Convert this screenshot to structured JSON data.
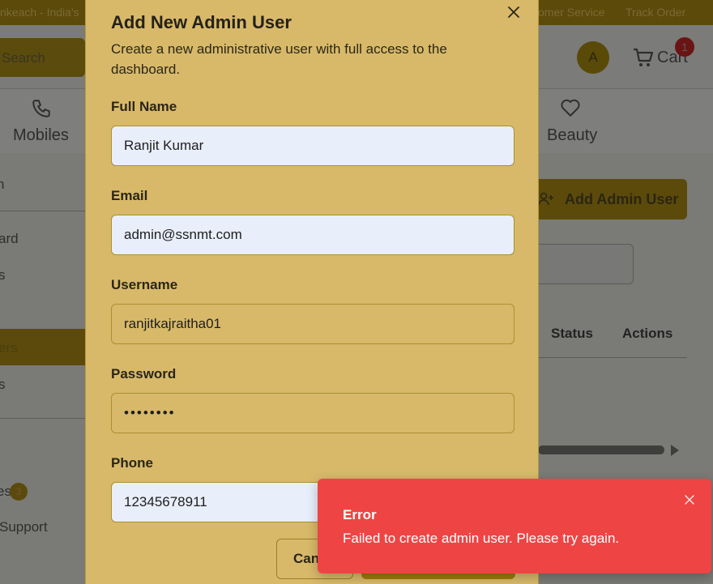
{
  "topbar": {
    "promo": "nkeach - India's",
    "customer_service": "omer Service",
    "track_order": "Track Order"
  },
  "header": {
    "search_placeholder": "Search",
    "avatar_initial": "A",
    "cart_label": "Cart",
    "cart_count": "1"
  },
  "categories": {
    "mobiles": "Mobiles",
    "beauty": "Beauty"
  },
  "sidebar": {
    "items": [
      "n",
      "ard",
      "s",
      "ers",
      "s",
      "es",
      "Support"
    ],
    "badge": "3"
  },
  "background": {
    "add_admin_label": "Add Admin User",
    "col_status": "Status",
    "col_actions": "Actions"
  },
  "modal": {
    "title": "Add New Admin User",
    "description": "Create a new administrative user with full access to the dashboard.",
    "fields": {
      "full_name": {
        "label": "Full Name",
        "value": "Ranjit Kumar"
      },
      "email": {
        "label": "Email",
        "value": "admin@ssnmt.com"
      },
      "username": {
        "label": "Username",
        "value": "ranjitkajraitha01"
      },
      "password": {
        "label": "Password",
        "value": "••••••••"
      },
      "phone": {
        "label": "Phone",
        "value": "12345678911"
      }
    },
    "cancel_label": "Cancel"
  },
  "toast": {
    "title": "Error",
    "message": "Failed to create admin user. Please try again."
  },
  "colors": {
    "modal_bg": "#d8b96a",
    "filled_input_bg": "#e9eefb",
    "toast_bg": "#ef4444",
    "brand_dark": "#5b4a0a"
  }
}
